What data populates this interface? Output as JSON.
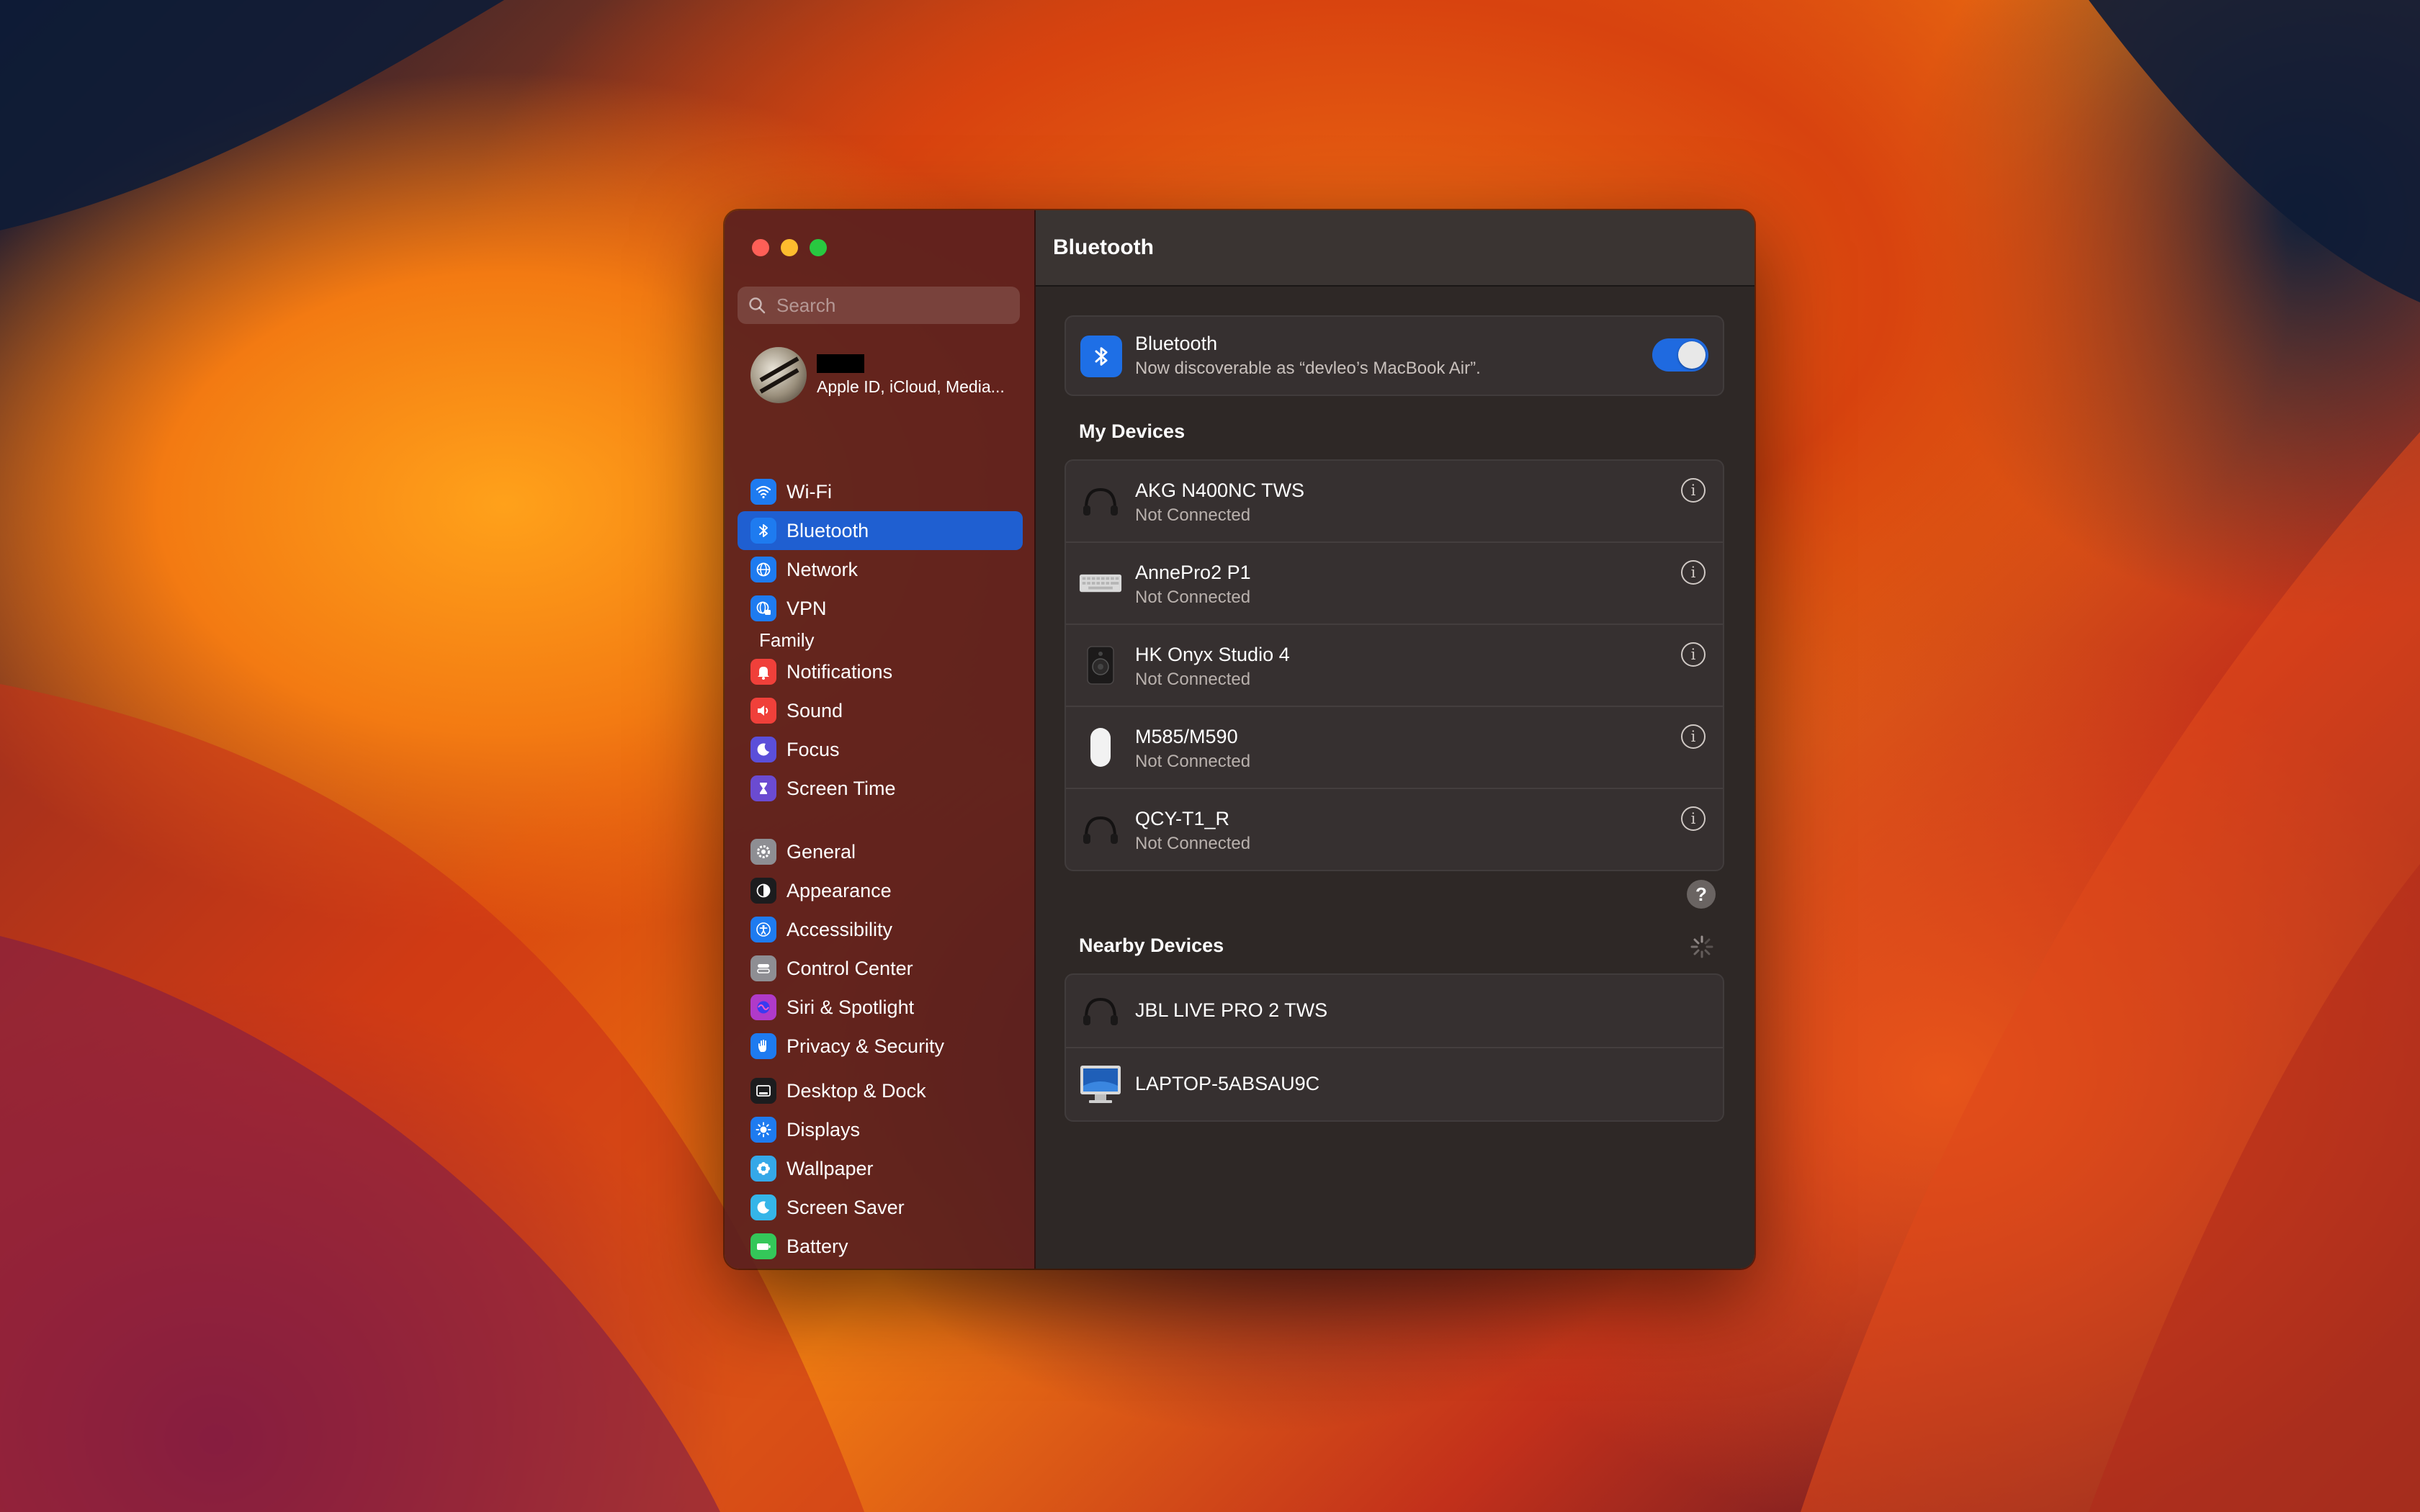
{
  "window": {
    "title": "Bluetooth"
  },
  "search": {
    "placeholder": "Search"
  },
  "profile": {
    "subtitle": "Apple ID, iCloud, Media..."
  },
  "family": "Family",
  "sidebar": {
    "groups": [
      [
        {
          "label": "Wi-Fi",
          "icon": "wifi-icon",
          "color": "#1e7bf0",
          "active": false
        },
        {
          "label": "Bluetooth",
          "icon": "bluetooth-icon",
          "color": "#1e7bf0",
          "active": true
        },
        {
          "label": "Network",
          "icon": "globe-icon",
          "color": "#1e7bf0",
          "active": false
        },
        {
          "label": "VPN",
          "icon": "vpn-globe-icon",
          "color": "#1e7bf0",
          "active": false
        }
      ],
      [
        {
          "label": "Notifications",
          "icon": "bell-icon",
          "color": "#f0403a",
          "active": false
        },
        {
          "label": "Sound",
          "icon": "speaker-icon",
          "color": "#f0403a",
          "active": false
        },
        {
          "label": "Focus",
          "icon": "moon-icon",
          "color": "#5b4fd9",
          "active": false
        },
        {
          "label": "Screen Time",
          "icon": "hourglass-icon",
          "color": "#6b4bd1",
          "active": false
        }
      ],
      [
        {
          "label": "General",
          "icon": "gear-icon",
          "color": "#8e8e93",
          "active": false
        },
        {
          "label": "Appearance",
          "icon": "appearance-icon",
          "color": "#1c1c1e",
          "active": false
        },
        {
          "label": "Accessibility",
          "icon": "accessibility-icon",
          "color": "#1e7bf0",
          "active": false
        },
        {
          "label": "Control Center",
          "icon": "control-center-icon",
          "color": "#8e8e93",
          "active": false
        },
        {
          "label": "Siri & Spotlight",
          "icon": "siri-icon",
          "color": "#b03ac9",
          "active": false
        },
        {
          "label": "Privacy & Security",
          "icon": "hand-icon",
          "color": "#1e7bf0",
          "active": false
        }
      ],
      [
        {
          "label": "Desktop & Dock",
          "icon": "dock-icon",
          "color": "#1c1c1e",
          "active": false
        },
        {
          "label": "Displays",
          "icon": "sun-icon",
          "color": "#1e7bf0",
          "active": false
        },
        {
          "label": "Wallpaper",
          "icon": "wallpaper-icon",
          "color": "#35a8e8",
          "active": false
        },
        {
          "label": "Screen Saver",
          "icon": "screensaver-icon",
          "color": "#35b5e8",
          "active": false
        },
        {
          "label": "Battery",
          "icon": "battery-icon",
          "color": "#34c759",
          "active": false
        }
      ]
    ]
  },
  "bluetooth": {
    "title": "Bluetooth",
    "subtitle": "Now discoverable as “devleo’s MacBook Air”.",
    "enabled": true
  },
  "my_devices": {
    "title": "My Devices",
    "items": [
      {
        "name": "AKG N400NC TWS",
        "status": "Not Connected",
        "icon": "earbuds-icon"
      },
      {
        "name": "AnnePro2 P1",
        "status": "Not Connected",
        "icon": "keyboard-icon"
      },
      {
        "name": "HK Onyx Studio 4",
        "status": "Not Connected",
        "icon": "speaker-device-icon"
      },
      {
        "name": "M585/M590",
        "status": "Not Connected",
        "icon": "mouse-icon"
      },
      {
        "name": "QCY-T1_R",
        "status": "Not Connected",
        "icon": "earbuds-icon"
      }
    ]
  },
  "nearby_devices": {
    "title": "Nearby Devices",
    "items": [
      {
        "name": "JBL LIVE PRO 2 TWS",
        "icon": "earbuds-icon"
      },
      {
        "name": "LAPTOP-5ABSAU9C",
        "icon": "monitor-icon"
      }
    ]
  },
  "help": "?"
}
